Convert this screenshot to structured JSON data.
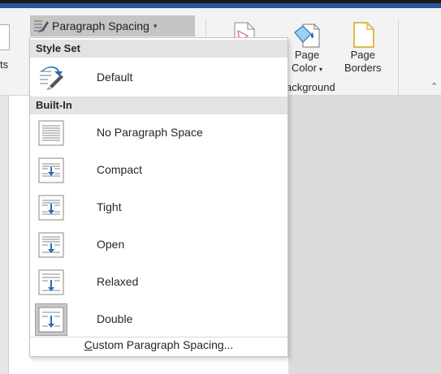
{
  "ribbon": {
    "paragraph_spacing_label": "Paragraph Spacing",
    "left_cut_text": "ts",
    "page_color_line1": "Page",
    "page_color_line2": "Color",
    "page_borders_line1": "Page",
    "page_borders_line2": "Borders",
    "group_label": "ackground"
  },
  "menu": {
    "style_set_header": "Style Set",
    "default_label": "Default",
    "builtin_header": "Built-In",
    "items": [
      {
        "label": "No Paragraph Space",
        "icon": "no-paragraph-space-icon"
      },
      {
        "label": "Compact",
        "icon": "compact-spacing-icon"
      },
      {
        "label": "Tight",
        "icon": "tight-spacing-icon"
      },
      {
        "label": "Open",
        "icon": "open-spacing-icon"
      },
      {
        "label": "Relaxed",
        "icon": "relaxed-spacing-icon"
      },
      {
        "label": "Double",
        "icon": "double-spacing-icon",
        "selected": true
      }
    ],
    "custom_prefix": "C",
    "custom_rest": "ustom Paragraph Spacing..."
  },
  "colors": {
    "accent_blue": "#2b6cb8",
    "selected_bg": "#c8c8c8",
    "header_bg": "#e3e3e3"
  }
}
